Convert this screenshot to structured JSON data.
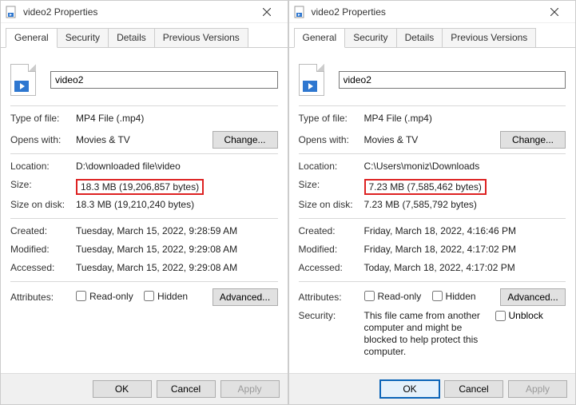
{
  "left": {
    "title": "video2 Properties",
    "tabs": [
      "General",
      "Security",
      "Details",
      "Previous Versions"
    ],
    "filename": "video2",
    "type_label": "Type of file:",
    "type_value": "MP4 File (.mp4)",
    "opens_label": "Opens with:",
    "opens_value": "Movies & TV",
    "change_btn": "Change...",
    "location_label": "Location:",
    "location_value": "D:\\downloaded file\\video",
    "size_label": "Size:",
    "size_value": "18.3 MB (19,206,857 bytes)",
    "sizeondisk_label": "Size on disk:",
    "sizeondisk_value": "18.3 MB (19,210,240 bytes)",
    "created_label": "Created:",
    "created_value": "Tuesday, March 15, 2022, 9:28:59 AM",
    "modified_label": "Modified:",
    "modified_value": "Tuesday, March 15, 2022, 9:29:08 AM",
    "accessed_label": "Accessed:",
    "accessed_value": "Tuesday, March 15, 2022, 9:29:08 AM",
    "attributes_label": "Attributes:",
    "readonly_label": "Read-only",
    "hidden_label": "Hidden",
    "advanced_btn": "Advanced...",
    "ok": "OK",
    "cancel": "Cancel",
    "apply": "Apply"
  },
  "right": {
    "title": "video2 Properties",
    "tabs": [
      "General",
      "Security",
      "Details",
      "Previous Versions"
    ],
    "filename": "video2",
    "type_label": "Type of file:",
    "type_value": "MP4 File (.mp4)",
    "opens_label": "Opens with:",
    "opens_value": "Movies & TV",
    "change_btn": "Change...",
    "location_label": "Location:",
    "location_value": "C:\\Users\\moniz\\Downloads",
    "size_label": "Size:",
    "size_value": "7.23 MB (7,585,462 bytes)",
    "sizeondisk_label": "Size on disk:",
    "sizeondisk_value": "7.23 MB (7,585,792 bytes)",
    "created_label": "Created:",
    "created_value": "Friday, March 18, 2022, 4:16:46 PM",
    "modified_label": "Modified:",
    "modified_value": "Friday, March 18, 2022, 4:17:02 PM",
    "accessed_label": "Accessed:",
    "accessed_value": "Today, March 18, 2022, 4:17:02 PM",
    "attributes_label": "Attributes:",
    "readonly_label": "Read-only",
    "hidden_label": "Hidden",
    "advanced_btn": "Advanced...",
    "security_label": "Security:",
    "security_note": "This file came from another computer and might be blocked to help protect this computer.",
    "unblock_label": "Unblock",
    "ok": "OK",
    "cancel": "Cancel",
    "apply": "Apply"
  }
}
